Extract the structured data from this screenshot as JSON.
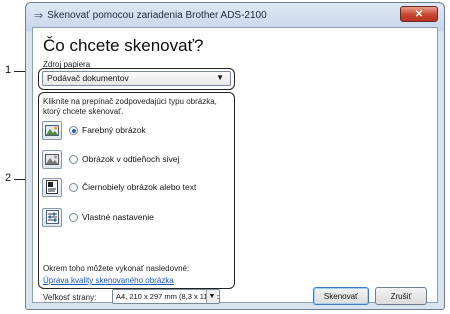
{
  "callouts": {
    "one": "1",
    "two": "2"
  },
  "window": {
    "title": "Skenovať pomocou zariadenia Brother ADS-2100",
    "close_label": "✕"
  },
  "dialog": {
    "heading": "Čo chcete skenovať?",
    "source_label": "Zdroj papiera",
    "source_value": "Podávač dokumentov",
    "instruction": "Kliknite na prepínač zodpovedajúci typu obrázka, ktorý chcete skenovať.",
    "options": [
      {
        "label": "Farebný obrázok",
        "checked": true,
        "icon": "color-picture-icon"
      },
      {
        "label": "Obrázok v odtieňoch sivej",
        "checked": false,
        "icon": "grayscale-picture-icon"
      },
      {
        "label": "Čiernobiely obrázok alebo text",
        "checked": false,
        "icon": "bw-text-icon"
      },
      {
        "label": "Vlastné nastavenie",
        "checked": false,
        "icon": "custom-settings-icon"
      }
    ],
    "extra_text": "Okrem toho môžete vykonať nasledovné:",
    "link_text": "Úprava kvality skenovaného obrázka",
    "page_size_label": "Veľkosť strany:",
    "page_size_value": "A4, 210 x 297 mm (8,3 x 11,7 pa",
    "scan_button": "Skenovať",
    "cancel_button": "Zrušiť"
  },
  "colors": {
    "accent": "#2f62b3",
    "link": "#1d58b8",
    "close": "#c9452e"
  }
}
